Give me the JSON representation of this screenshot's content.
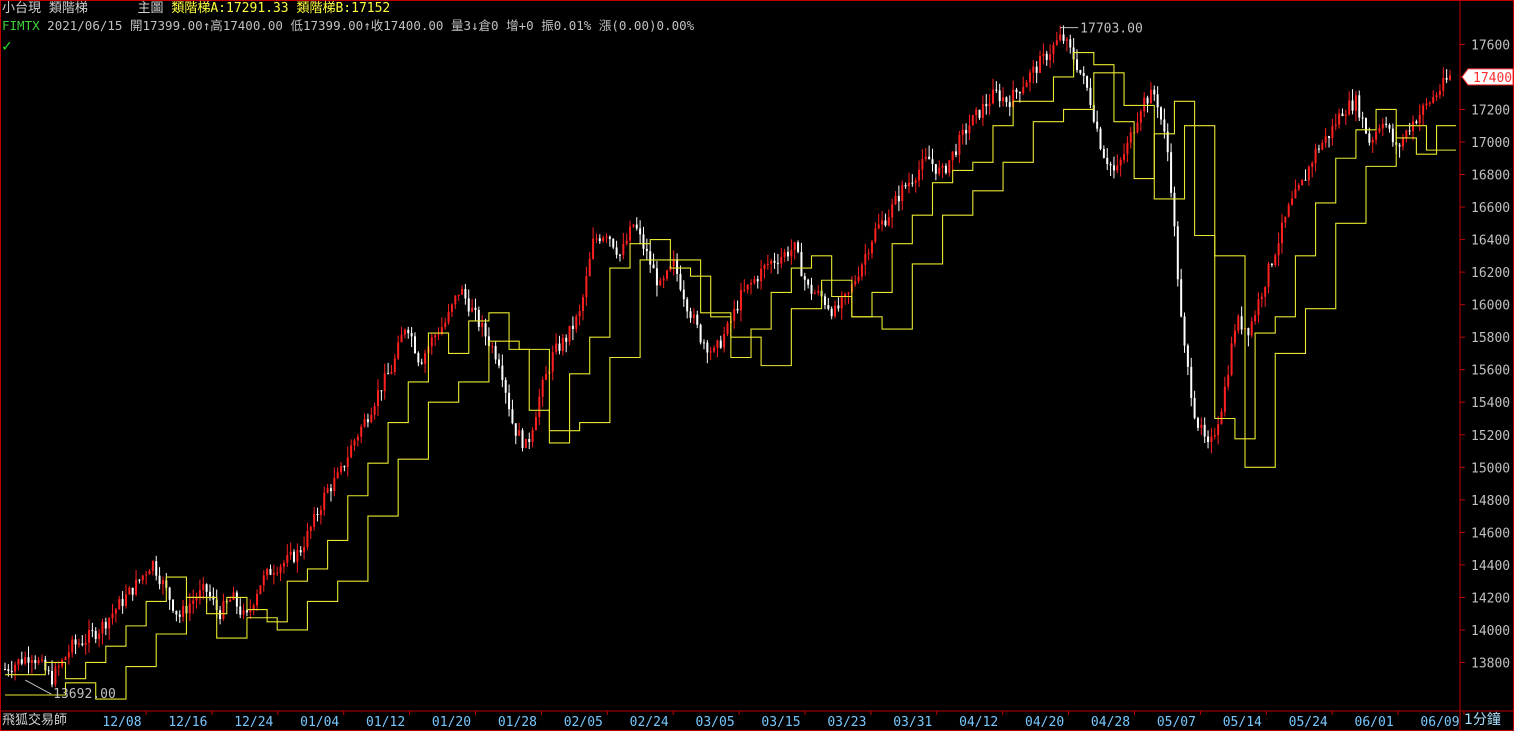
{
  "header": {
    "symbol_name": "小台現",
    "indicator_name": "類階梯",
    "main_chart_label": "主圖",
    "ladder_a": "類階梯A:17291.33",
    "ladder_b": "類階梯B:17152"
  },
  "quote": {
    "symbol": "FIMTX",
    "date": "2021/06/15",
    "open": "開17399.00",
    "high": "高17400.00",
    "low": "低17399.00",
    "close": "收17400.00",
    "volume": "量3",
    "open_interest": "倉0",
    "oi_change": "增+0",
    "amplitude": "振0.01%",
    "change": "漲(0.00)0.00%",
    "up_arrow": "↑",
    "down_arrow": "↓"
  },
  "footer": {
    "app_label": "飛狐交易師",
    "timeframe": "1分鐘"
  },
  "colors": {
    "background": "#000000",
    "up_candle": "#ff2020",
    "down_candle": "#ffffff",
    "ladder_line": "#e8e830",
    "axis": "#c00000",
    "tick_text": "#c0c0c0",
    "date_text": "#78c8ff",
    "price_tag": "#ff3030"
  },
  "chart_data": {
    "type": "candlestick",
    "title": "",
    "xlabel": "",
    "ylabel": "",
    "ylim": [
      13600,
      17750
    ],
    "yticks": [
      13800,
      14000,
      14200,
      14400,
      14600,
      14800,
      15000,
      15200,
      15400,
      15600,
      15800,
      16000,
      16200,
      16400,
      16600,
      16800,
      17000,
      17200,
      17400,
      17600
    ],
    "date_labels": [
      "12/08",
      "12/16",
      "12/24",
      "01/04",
      "01/12",
      "01/20",
      "01/28",
      "02/05",
      "02/24",
      "03/05",
      "03/15",
      "03/23",
      "03/31",
      "04/12",
      "04/20",
      "04/28",
      "05/07",
      "05/14",
      "05/24",
      "06/01",
      "06/09"
    ],
    "last_price": "17400",
    "max_label": "17703.00",
    "max_value": 17703,
    "min_label": "13692.00",
    "min_value": 13692,
    "price_path": [
      [
        0,
        13760
      ],
      [
        8,
        13850
      ],
      [
        14,
        13700
      ],
      [
        20,
        13900
      ],
      [
        24,
        13940
      ],
      [
        28,
        14000
      ],
      [
        32,
        14100
      ],
      [
        36,
        14200
      ],
      [
        40,
        14300
      ],
      [
        44,
        14420
      ],
      [
        48,
        14250
      ],
      [
        52,
        14080
      ],
      [
        56,
        14180
      ],
      [
        60,
        14250
      ],
      [
        64,
        14100
      ],
      [
        68,
        14200
      ],
      [
        72,
        14060
      ],
      [
        76,
        14280
      ],
      [
        80,
        14380
      ],
      [
        84,
        14420
      ],
      [
        88,
        14480
      ],
      [
        92,
        14650
      ],
      [
        96,
        14850
      ],
      [
        100,
        14950
      ],
      [
        104,
        15150
      ],
      [
        108,
        15300
      ],
      [
        112,
        15480
      ],
      [
        116,
        15620
      ],
      [
        120,
        15900
      ],
      [
        124,
        15650
      ],
      [
        128,
        15800
      ],
      [
        132,
        15900
      ],
      [
        136,
        16100
      ],
      [
        140,
        15950
      ],
      [
        144,
        15800
      ],
      [
        148,
        15650
      ],
      [
        152,
        15250
      ],
      [
        156,
        15120
      ],
      [
        160,
        15450
      ],
      [
        164,
        15700
      ],
      [
        168,
        15800
      ],
      [
        172,
        15950
      ],
      [
        176,
        16400
      ],
      [
        180,
        16450
      ],
      [
        184,
        16300
      ],
      [
        188,
        16500
      ],
      [
        192,
        16300
      ],
      [
        196,
        16100
      ],
      [
        200,
        16250
      ],
      [
        204,
        16000
      ],
      [
        208,
        15800
      ],
      [
        212,
        15700
      ],
      [
        216,
        15850
      ],
      [
        220,
        16050
      ],
      [
        224,
        16150
      ],
      [
        228,
        16250
      ],
      [
        232,
        16300
      ],
      [
        236,
        16350
      ],
      [
        240,
        16100
      ],
      [
        244,
        16050
      ],
      [
        248,
        15950
      ],
      [
        252,
        16050
      ],
      [
        256,
        16250
      ],
      [
        260,
        16450
      ],
      [
        264,
        16550
      ],
      [
        268,
        16700
      ],
      [
        272,
        16800
      ],
      [
        276,
        16900
      ],
      [
        280,
        16800
      ],
      [
        284,
        16950
      ],
      [
        288,
        17100
      ],
      [
        292,
        17200
      ],
      [
        296,
        17300
      ],
      [
        300,
        17250
      ],
      [
        304,
        17350
      ],
      [
        308,
        17450
      ],
      [
        312,
        17550
      ],
      [
        316,
        17650
      ],
      [
        320,
        17500
      ],
      [
        324,
        17300
      ],
      [
        328,
        16950
      ],
      [
        332,
        16800
      ],
      [
        336,
        17000
      ],
      [
        340,
        17250
      ],
      [
        344,
        17300
      ],
      [
        348,
        16900
      ],
      [
        352,
        15800
      ],
      [
        356,
        15300
      ],
      [
        360,
        15100
      ],
      [
        364,
        15400
      ],
      [
        368,
        15900
      ],
      [
        372,
        15850
      ],
      [
        376,
        16100
      ],
      [
        380,
        16350
      ],
      [
        384,
        16600
      ],
      [
        388,
        16750
      ],
      [
        392,
        16950
      ],
      [
        396,
        17050
      ],
      [
        400,
        17200
      ],
      [
        404,
        17250
      ],
      [
        408,
        17000
      ],
      [
        412,
        17150
      ],
      [
        416,
        16950
      ],
      [
        420,
        17100
      ],
      [
        424,
        17200
      ],
      [
        428,
        17300
      ],
      [
        432,
        17400
      ]
    ],
    "ladder_a_last": 17291.33,
    "ladder_b_last": 17152
  }
}
